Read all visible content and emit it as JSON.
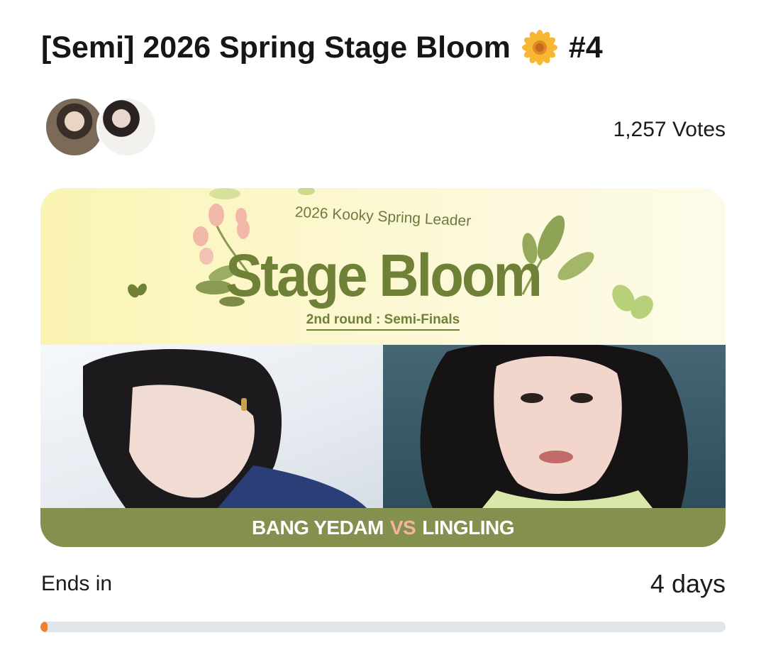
{
  "poll": {
    "title": "[Semi] 2026 Spring Stage Bloom",
    "title_emoji": "sunflower-icon",
    "title_suffix": "#4",
    "votes": "1,257 Votes",
    "avatars": [
      "avatar-bang-yedam",
      "avatar-lingling"
    ]
  },
  "banner": {
    "subheading": "2026 Kooky Spring Leader",
    "logo": "Stage Bloom",
    "round": "2nd round : Semi-Finals",
    "contestant_left": "BANG YEDAM",
    "vs": "VS",
    "contestant_right": "LINGLING"
  },
  "status": {
    "ends_label": "Ends in",
    "ends_value": "4 days",
    "progress_fraction": 0.01
  },
  "colors": {
    "accent_green": "#84904d",
    "progress": "#f07f2f",
    "vs_color": "#f1b5a1"
  }
}
